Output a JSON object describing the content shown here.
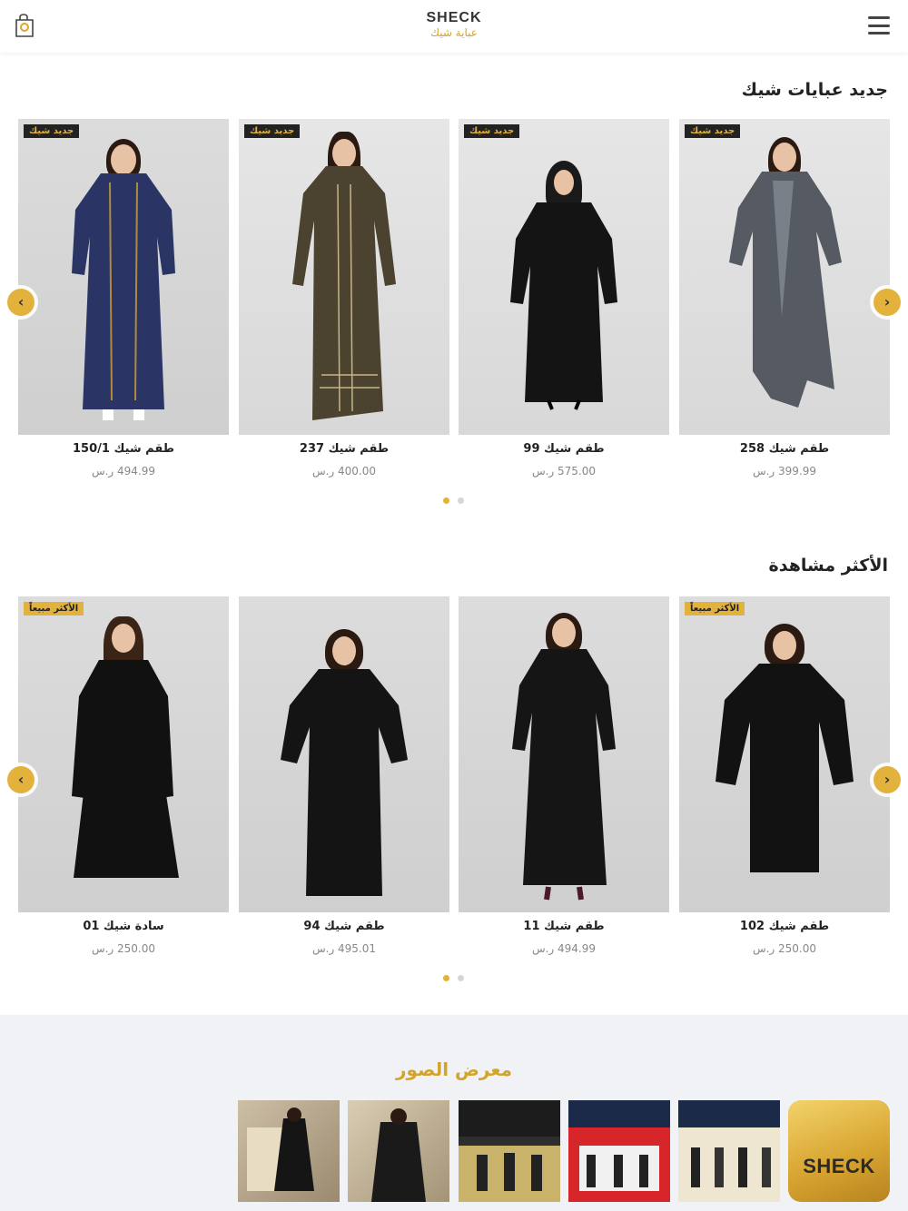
{
  "header": {
    "logo_en": "SHECK",
    "logo_ar": "عباية شيك",
    "cart_icon": "cart-icon",
    "menu_icon": "hamburger-menu-icon"
  },
  "new_section": {
    "title": "جديد عبايات شيك",
    "products": [
      {
        "badge": "جديد شيك",
        "name": "طقم شيك 150/1",
        "price": "494.99 ر.س"
      },
      {
        "badge": "جديد شيك",
        "name": "طقم شيك 237",
        "price": "400.00 ر.س"
      },
      {
        "badge": "جديد شيك",
        "name": "طقم شيك 99",
        "price": "575.00 ر.س"
      },
      {
        "badge": "جديد شيك",
        "name": "طقم شيك 258",
        "price": "399.99 ر.س"
      }
    ],
    "prev_icon": "chevron-left-icon",
    "next_icon": "chevron-right-icon"
  },
  "popular_section": {
    "title": "الأكثر مشاهدة",
    "products": [
      {
        "badge": "الأكثر مبيعاً",
        "name": "سادة شيك 01",
        "price": "250.00 ر.س"
      },
      {
        "badge": "",
        "name": "طقم شيك 94",
        "price": "495.01 ر.س"
      },
      {
        "badge": "",
        "name": "طقم شيك 11",
        "price": "494.99 ر.س"
      },
      {
        "badge": "الأكثر مبيعاً",
        "name": "طقم شيك 102",
        "price": "250.00 ر.س"
      }
    ]
  },
  "gallery": {
    "title": "معرض الصور",
    "logo_text": "SHECK"
  },
  "colors": {
    "accent": "#e3b23c",
    "badge_dark": "#222222",
    "dot_inactive": "#d6d6d6"
  }
}
